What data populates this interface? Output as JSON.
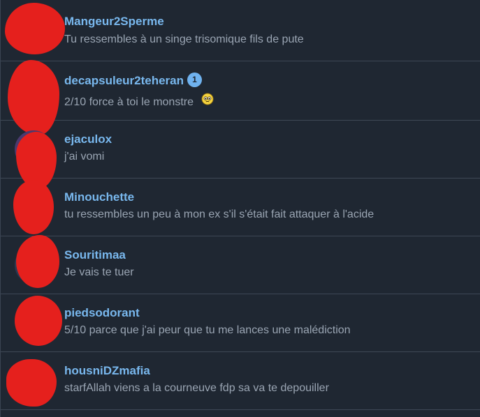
{
  "conversations": [
    {
      "username": "Mangeur2Sperme",
      "message": "Tu ressembles à un singe trisomique fils de pute"
    },
    {
      "username": "decapsuleur2teheran",
      "message": "2/10 force à toi le monstre",
      "unread_count": "1",
      "emoji": "pleading-face-emoji"
    },
    {
      "username": "ejaculox",
      "message": "j'ai vomi"
    },
    {
      "username": "Minouchette",
      "message": "tu ressembles un peu à mon ex s'il s'était fait attaquer à l'acide"
    },
    {
      "username": "Souritimaa",
      "message": "Je vais te tuer"
    },
    {
      "username": "piedsodorant",
      "message": "5/10 parce que j'ai peur que tu me lances une malédiction"
    },
    {
      "username": "housniDZmafia",
      "message": "starfAllah viens a la courneuve fdp sa va te depouiller"
    }
  ],
  "colors": {
    "background": "#1f2732",
    "username": "#79b8ee",
    "message": "#9aa5b3",
    "divider": "#3e4856",
    "badge": "#6fb2ef",
    "redaction": "#e5201d"
  }
}
